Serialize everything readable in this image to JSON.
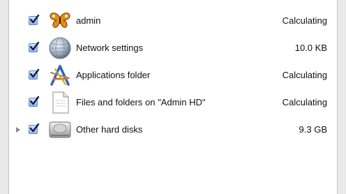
{
  "items": [
    {
      "label": "admin",
      "size": "Calculating",
      "checked": true,
      "icon": "butterfly-icon"
    },
    {
      "label": "Network settings",
      "size": "10.0 KB",
      "checked": true,
      "icon": "network-globe-icon"
    },
    {
      "label": "Applications folder",
      "size": "Calculating",
      "checked": true,
      "icon": "applications-icon"
    },
    {
      "label": "Files and folders on \"Admin HD\"",
      "size": "Calculating",
      "checked": true,
      "icon": "document-icon"
    },
    {
      "label": "Other hard disks",
      "size": "9.3 GB",
      "checked": true,
      "icon": "hard-disk-icon",
      "expandable": true
    }
  ],
  "colors": {
    "checkbox_fill": "#8fb3ea",
    "checkmark": "#0d1a52",
    "butterfly": "#e58a1a"
  }
}
